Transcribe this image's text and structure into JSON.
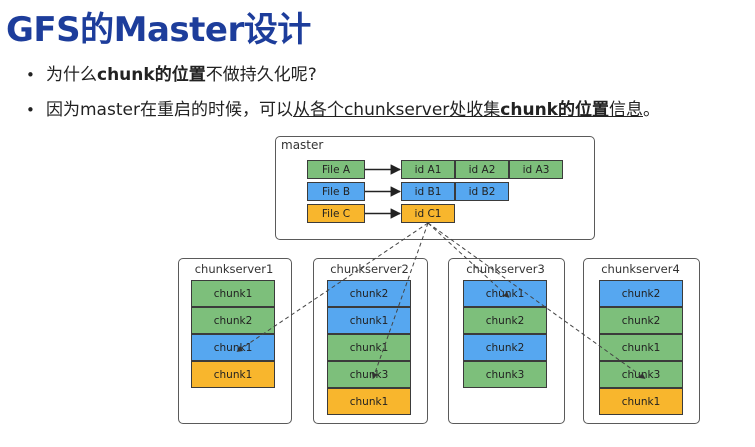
{
  "slide": {
    "title": "GFS的Master设计",
    "bullet1": {
      "pre": "为什么",
      "bold": "chunk的位置",
      "post": "不做持久化呢?"
    },
    "bullet2": {
      "pre": "因为master在重启的时候，可以",
      "u1": "从各个chunkserver处收集",
      "bold": "chunk的位置",
      "u2": "信息",
      "post": "。"
    }
  },
  "diagram": {
    "colors": {
      "green": "#7dbf7b",
      "blue": "#56a7f0",
      "orange": "#f8b62d"
    },
    "master": {
      "label": "master",
      "files": [
        {
          "label": "File A",
          "color": "green"
        },
        {
          "label": "File B",
          "color": "blue"
        },
        {
          "label": "File C",
          "color": "orange"
        }
      ],
      "chunk_ids": [
        [
          "id A1",
          "id A2",
          "id A3"
        ],
        [
          "id B1",
          "id B2"
        ],
        [
          "id C1"
        ]
      ]
    },
    "chunkservers": [
      {
        "label": "chunkserver1",
        "chunks": [
          {
            "label": "chunk1",
            "color": "green"
          },
          {
            "label": "chunk2",
            "color": "green"
          },
          {
            "label": "chunk1",
            "color": "blue"
          },
          {
            "label": "chunk1",
            "color": "orange"
          }
        ]
      },
      {
        "label": "chunkserver2",
        "chunks": [
          {
            "label": "chunk2",
            "color": "blue"
          },
          {
            "label": "chunk1",
            "color": "blue"
          },
          {
            "label": "chunk1",
            "color": "green"
          },
          {
            "label": "chunk3",
            "color": "green"
          },
          {
            "label": "chunk1",
            "color": "orange"
          }
        ]
      },
      {
        "label": "chunkserver3",
        "chunks": [
          {
            "label": "chunk1",
            "color": "blue"
          },
          {
            "label": "chunk2",
            "color": "green"
          },
          {
            "label": "chunk2",
            "color": "blue"
          },
          {
            "label": "chunk3",
            "color": "green"
          }
        ]
      },
      {
        "label": "chunkserver4",
        "chunks": [
          {
            "label": "chunk2",
            "color": "blue"
          },
          {
            "label": "chunk2",
            "color": "green"
          },
          {
            "label": "chunk1",
            "color": "green"
          },
          {
            "label": "chunk3",
            "color": "green"
          },
          {
            "label": "chunk1",
            "color": "orange"
          }
        ]
      }
    ]
  }
}
